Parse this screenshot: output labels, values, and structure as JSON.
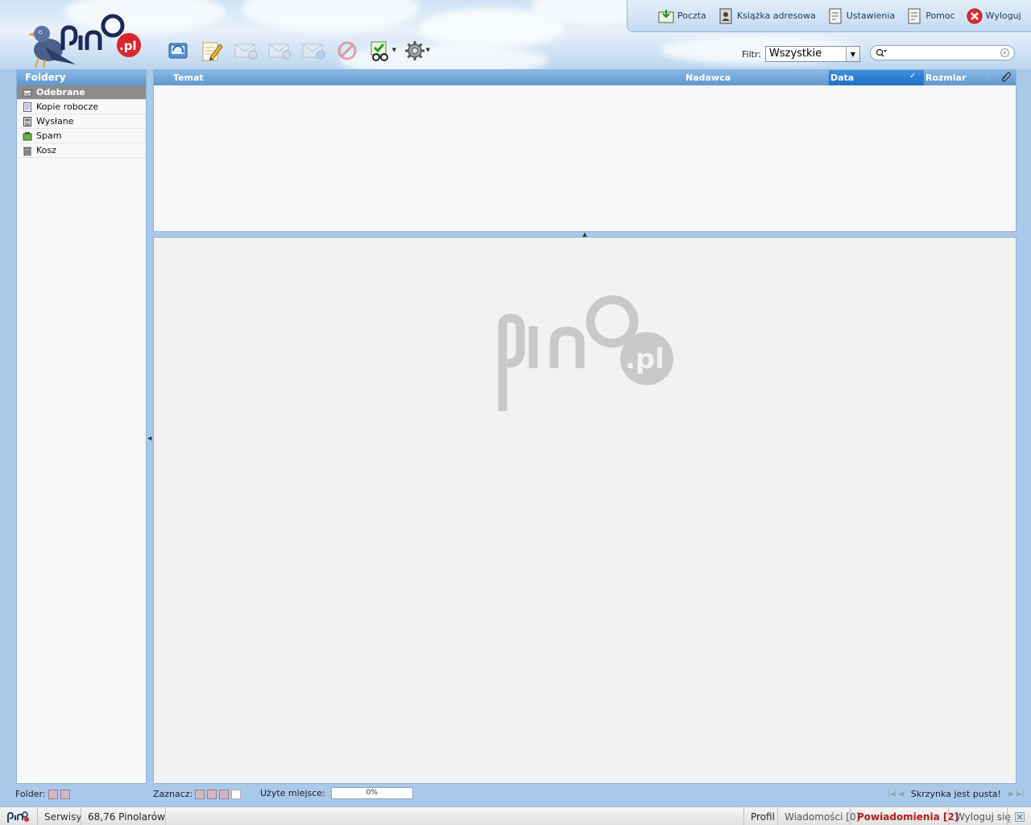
{
  "app": {
    "name": "pino.pl"
  },
  "topnav": {
    "items": [
      {
        "label": "Poczta",
        "icon": "mail-download-icon"
      },
      {
        "label": "Książka adresowa",
        "icon": "address-book-icon"
      },
      {
        "label": "Ustawienia",
        "icon": "settings-doc-icon"
      },
      {
        "label": "Pomoc",
        "icon": "help-doc-icon"
      },
      {
        "label": "Wyloguj",
        "icon": "logout-red-x-icon"
      }
    ]
  },
  "toolbar": {
    "buttons": [
      {
        "name": "check-mail",
        "icon": "receive-mail-icon",
        "enabled": true
      },
      {
        "name": "compose",
        "icon": "pencil-compose-icon",
        "enabled": true
      },
      {
        "name": "reply",
        "icon": "reply-envelope-icon",
        "enabled": false
      },
      {
        "name": "reply-all",
        "icon": "reply-all-envelope-icon",
        "enabled": false
      },
      {
        "name": "forward",
        "icon": "forward-envelope-icon",
        "enabled": false
      },
      {
        "name": "delete",
        "icon": "no-entry-icon",
        "enabled": false
      },
      {
        "name": "mark",
        "icon": "mark-read-glasses-icon",
        "enabled": true
      },
      {
        "name": "options",
        "icon": "gear-icon",
        "enabled": true
      }
    ]
  },
  "filter": {
    "label": "Filtr:",
    "selected": "Wszystkie"
  },
  "search": {
    "placeholder": ""
  },
  "folders": {
    "title": "Foldery",
    "items": [
      {
        "label": "Odebrane",
        "icon": "inbox-icon",
        "active": true
      },
      {
        "label": "Kopie robocze",
        "icon": "drafts-icon",
        "active": false
      },
      {
        "label": "Wysłane",
        "icon": "sent-icon",
        "active": false
      },
      {
        "label": "Spam",
        "icon": "spam-icon",
        "active": false
      },
      {
        "label": "Kosz",
        "icon": "trash-icon",
        "active": false
      }
    ]
  },
  "message_list": {
    "columns": {
      "subject": "Temat",
      "sender": "Nadawca",
      "date": "Data",
      "size": "Rozmiar"
    },
    "sorted_by": "Data",
    "rows": []
  },
  "statusbar": {
    "folder_label": "Folder:",
    "select_label": "Zaznacz:",
    "quota_label": "Użyte miejsce:",
    "quota_value": "0%",
    "quota_fraction": 0,
    "empty_message": "Skrzynka jest pusta!"
  },
  "bottombar": {
    "services": "Serwisy",
    "balance": "68,76 Pinolarów",
    "profile": "Profil",
    "messages": "Wiadomości [0]",
    "notifications": "Powiadomienia [2]",
    "logout": "Wyloguj się"
  },
  "colors": {
    "header_blue": "#5f97cf",
    "active_folder": "#8c8c8c",
    "notifications_red": "#b11c1c",
    "logo_red": "#d9262c",
    "logo_navy": "#1a2a5a"
  }
}
